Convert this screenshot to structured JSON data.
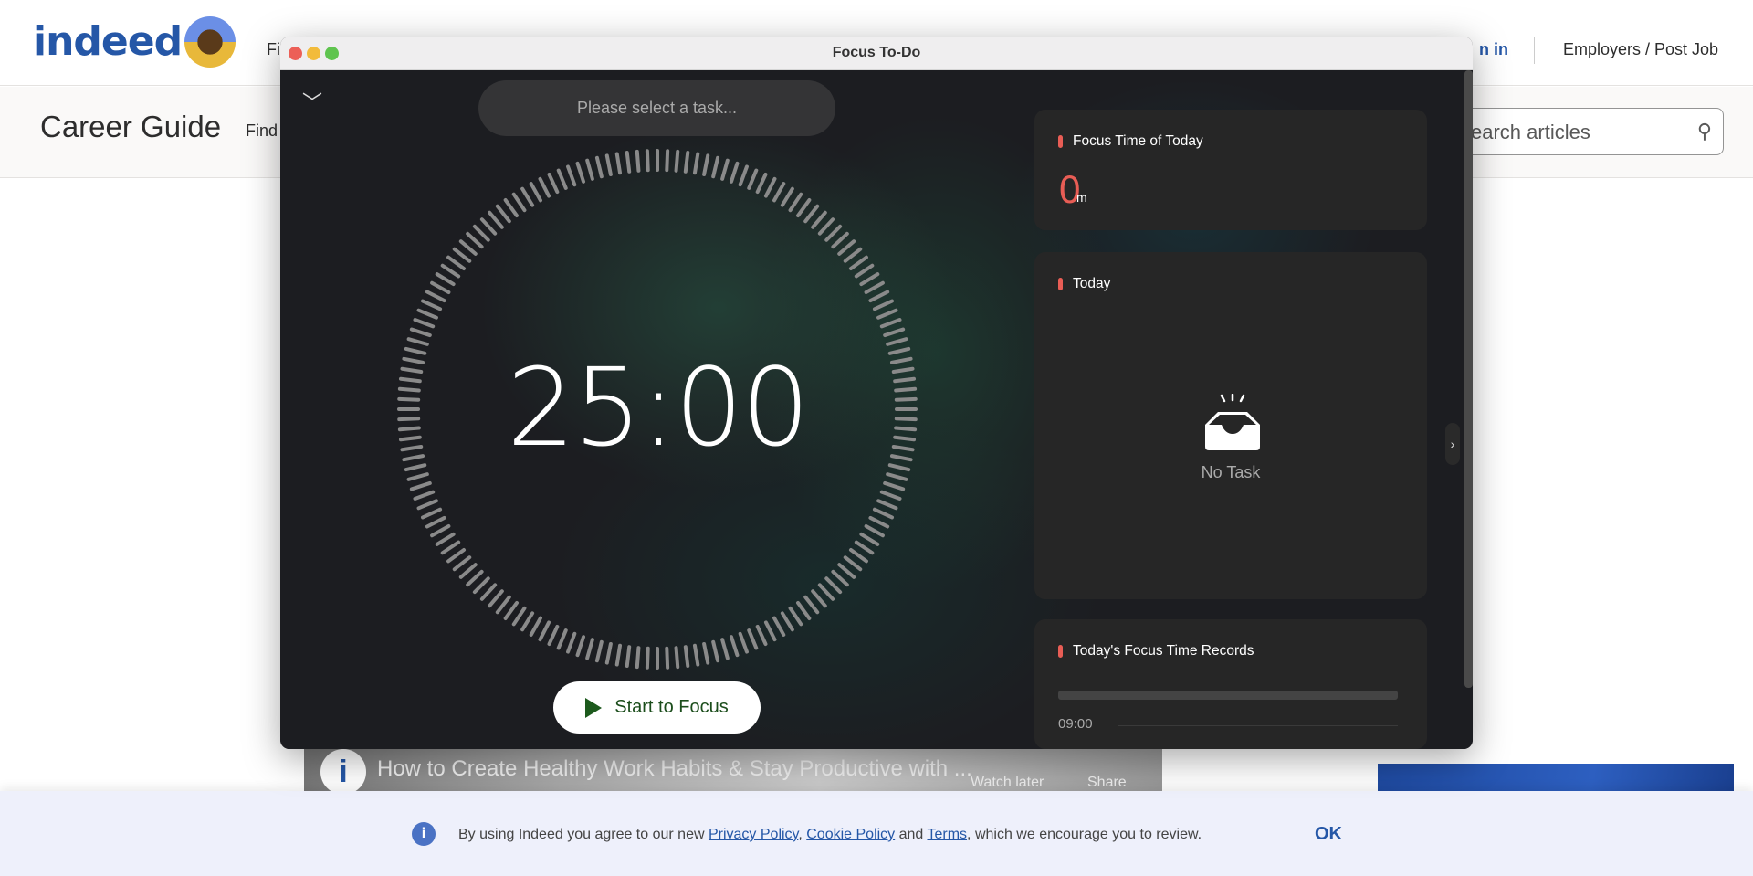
{
  "indeed": {
    "logo": "indeed",
    "nav_partial": "Fi",
    "sign_in_partial": "n in",
    "employers": "Employers / Post Job",
    "career_guide": "Career Guide",
    "find_partial": "Find",
    "search_placeholder_partial": "earch articles"
  },
  "video": {
    "title": "How to Create Healthy Work Habits & Stay Productive with ...",
    "channel_logo": "i",
    "watch_later": "Watch later",
    "share": "Share"
  },
  "cookie": {
    "prefix": "By using Indeed you agree to our new ",
    "privacy": "Privacy Policy",
    "comma": ", ",
    "cookie_policy": "Cookie Policy",
    "and": " and ",
    "terms": "Terms",
    "suffix": ", which we encourage you to review.",
    "ok": "OK"
  },
  "app": {
    "title": "Focus To-Do",
    "task_placeholder": "Please select a task...",
    "timer": "25:00",
    "start": "Start to Focus",
    "cards": {
      "focus_time_title": "Focus Time of Today",
      "focus_value": "0",
      "focus_unit": "m",
      "today_title": "Today",
      "no_task": "No Task",
      "records_title": "Today's Focus Time Records",
      "record_time": "09:00"
    }
  },
  "colors": {
    "accent": "#e85d55",
    "indeed_blue": "#2557a7",
    "start_green": "#1d5a1d"
  }
}
